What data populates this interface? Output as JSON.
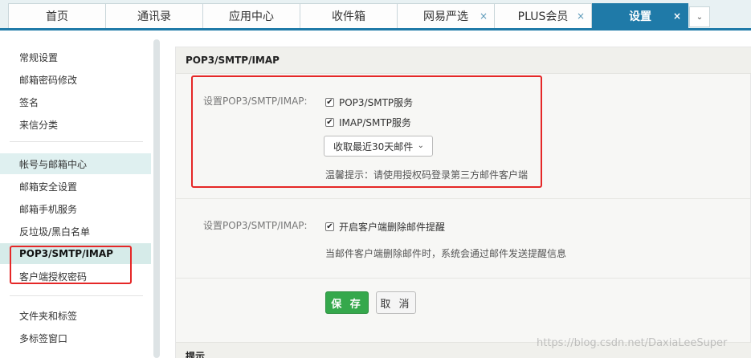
{
  "tabs": [
    {
      "label": "首页",
      "closable": false
    },
    {
      "label": "通讯录",
      "closable": false
    },
    {
      "label": "应用中心",
      "closable": false
    },
    {
      "label": "收件箱",
      "closable": false
    },
    {
      "label": "网易严选",
      "closable": true
    },
    {
      "label": "PLUS会员",
      "closable": true
    },
    {
      "label": "设置",
      "closable": true,
      "active": true
    }
  ],
  "tab_close_glyph": "×",
  "tab_more_glyph": "⌄",
  "sidebar": {
    "items": [
      {
        "label": "常规设置"
      },
      {
        "label": "邮箱密码修改"
      },
      {
        "label": "签名"
      },
      {
        "label": "来信分类"
      },
      {
        "label": "帐号与邮箱中心"
      },
      {
        "label": "邮箱安全设置"
      },
      {
        "label": "邮箱手机服务"
      },
      {
        "label": "反垃圾/黑白名单"
      },
      {
        "label": "POP3/SMTP/IMAP",
        "selected": true
      },
      {
        "label": "客户端授权密码"
      },
      {
        "label": "文件夹和标签"
      },
      {
        "label": "多标签窗口"
      }
    ]
  },
  "main": {
    "section_title": "POP3/SMTP/IMAP",
    "setting1": {
      "label": "设置POP3/SMTP/IMAP:",
      "opt1": "POP3/SMTP服务",
      "opt2": "IMAP/SMTP服务",
      "dropdown": "收取最近30天邮件",
      "tip": "温馨提示：请使用授权码登录第三方邮件客户端"
    },
    "setting2": {
      "label": "设置POP3/SMTP/IMAP:",
      "opt1": "开启客户端删除邮件提醒",
      "desc": "当邮件客户端删除邮件时，系统会通过邮件发送提醒信息"
    },
    "save_label": "保 存",
    "cancel_label": "取 消",
    "next_section_title": "提示"
  },
  "watermark": "https://blog.csdn.net/DaxiaLeeSuper",
  "colors": {
    "accent": "#1f7aa8",
    "save": "#35a84c",
    "highlight_box": "#e52727"
  }
}
